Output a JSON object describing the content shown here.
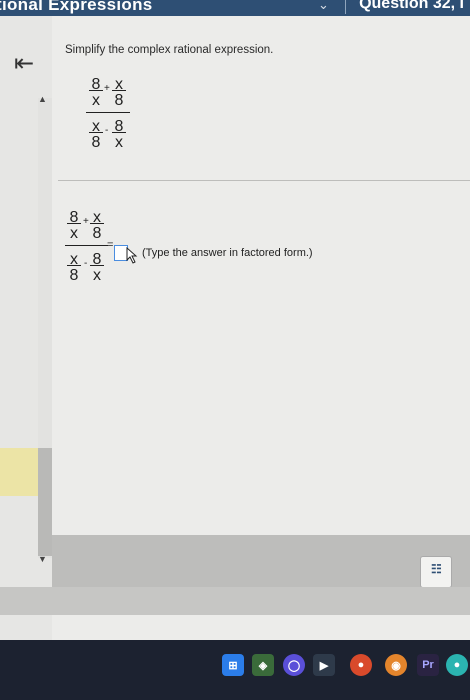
{
  "header": {
    "title": "tional Expressions",
    "question_label": "Question 32, I"
  },
  "main": {
    "prompt": "Simplify the complex rational expression.",
    "expression": {
      "top_left": {
        "num": "8",
        "den": "x"
      },
      "top_op": "+",
      "top_right": {
        "num": "x",
        "den": "8"
      },
      "bottom_left": {
        "num": "x",
        "den": "8"
      },
      "bottom_op": "-",
      "bottom_right": {
        "num": "8",
        "den": "x"
      }
    },
    "equals": "=",
    "answer_value": "",
    "hint": "(Type the answer in factored form.)"
  },
  "icons": [
    "back-to-start-icon",
    "scroll-up-icon",
    "scroll-down-icon",
    "calculator-icon",
    "windows-start-icon",
    "taskbar-app-icons"
  ],
  "colors": {
    "header_bg": "#2e4f74",
    "answer_border": "#4a8de0",
    "taskbar_bg": "#1c2230"
  },
  "taskbar": {
    "pr_label": "Pr"
  }
}
